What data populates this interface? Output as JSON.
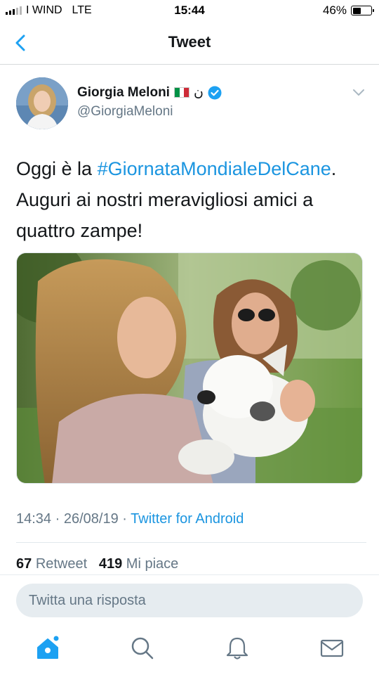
{
  "status_bar": {
    "carrier": "I WIND",
    "network": "LTE",
    "time": "15:44",
    "battery": "46%"
  },
  "nav": {
    "title": "Tweet"
  },
  "tweet": {
    "author_name": "Giorgia Meloni",
    "name_symbol": "ن",
    "handle": "@GiorgiaMeloni",
    "text_before": "Oggi è la ",
    "hashtag": "#GiornataMondialeDelCane",
    "text_after": ". Auguri ai nostri meravigliosi amici a quattro zampe!",
    "time": "14:34",
    "separator": "·",
    "date": "26/08/19",
    "source": "Twitter for Android",
    "retweets": "67",
    "retweets_label": "Retweet",
    "likes": "419",
    "likes_label": "Mi piace"
  },
  "reply": {
    "placeholder": "Twitta una risposta"
  },
  "tabs": [
    "home-icon",
    "search-icon",
    "notifications-icon",
    "messages-icon"
  ],
  "colors": {
    "accent": "#1b95e0",
    "verified": "#1da1f2",
    "secondary_text": "#657786"
  }
}
